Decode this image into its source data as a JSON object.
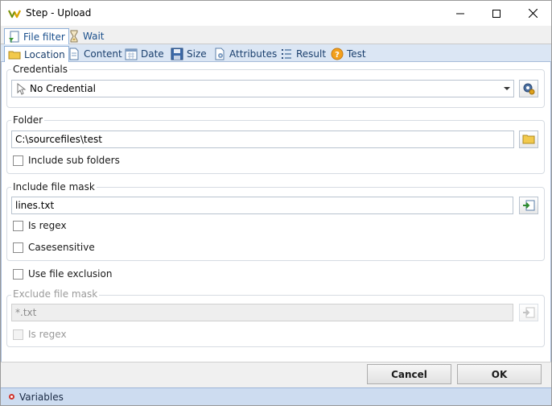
{
  "window": {
    "title": "Step - Upload",
    "minimize_glyph": "—",
    "maximize_glyph": "☐",
    "close_glyph": "✕"
  },
  "top_tabs": [
    {
      "label": "File filter",
      "icon": "file-filter-icon",
      "active": true
    },
    {
      "label": "Wait",
      "icon": "hourglass-icon",
      "active": false
    }
  ],
  "sub_tabs": [
    {
      "label": "Location",
      "icon": "folder-icon",
      "active": true
    },
    {
      "label": "Content",
      "icon": "document-icon",
      "active": false
    },
    {
      "label": "Date",
      "icon": "calendar-icon",
      "active": false
    },
    {
      "label": "Size",
      "icon": "disk-icon",
      "active": false
    },
    {
      "label": "Attributes",
      "icon": "attributes-icon",
      "active": false
    },
    {
      "label": "Result",
      "icon": "list-icon",
      "active": false
    },
    {
      "label": "Test",
      "icon": "help-icon",
      "active": false
    }
  ],
  "credentials": {
    "group_label": "Credentials",
    "selected": "No Credential"
  },
  "folder": {
    "group_label": "Folder",
    "value": "C:\\sourcefiles\\test",
    "include_sub_folders_label": "Include sub folders",
    "include_sub_folders": false
  },
  "include_mask": {
    "group_label": "Include file mask",
    "value": "lines.txt",
    "is_regex_label": "Is regex",
    "is_regex": false,
    "casesensitive_label": "Casesensitive",
    "casesensitive": false
  },
  "exclusion": {
    "use_label": "Use file exclusion",
    "use": false,
    "group_label": "Exclude file mask",
    "value": "*.txt",
    "is_regex_label": "Is regex",
    "is_regex": false
  },
  "buttons": {
    "cancel": "Cancel",
    "ok": "OK"
  },
  "variables_bar": {
    "label": "Variables"
  },
  "colors": {
    "accent_blue": "#1a4f8c",
    "tab_bar": "#dbe6f4",
    "variables_bar": "#cddcf0",
    "folder_yellow": "#f2c94c"
  }
}
